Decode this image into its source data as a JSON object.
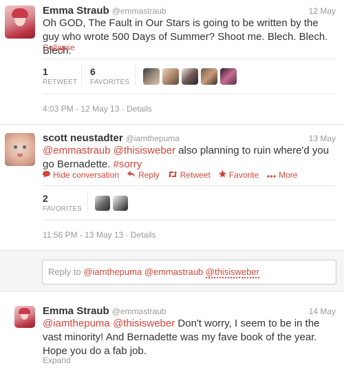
{
  "tweet1": {
    "name": "Emma Straub",
    "handle": "@emmastraub",
    "date": "12 May",
    "text": "Oh GOD, The Fault in Our Stars is going to be written by the guy who wrote 500 Days of Summer? Shoot me. Blech. Blech. Blech.",
    "collapse": "Collapse",
    "retweets_count": "1",
    "retweets_label": "RETWEET",
    "favorites_count": "6",
    "favorites_label": "FAVORITES",
    "timestamp": "4:03 PM - 12 May 13",
    "details": "Details"
  },
  "tweet2": {
    "name": "scott neustadter",
    "handle": "@iamthepuma",
    "date": "13 May",
    "mention1": "@emmastraub",
    "mention2": "@thisisweber",
    "text": "also planning to ruin where'd you go Bernadette.",
    "hashtag": "#sorry",
    "actions": {
      "hide": "Hide conversation",
      "reply": "Reply",
      "retweet": "Retweet",
      "favorite": "Favorite",
      "more": "More"
    },
    "favorites_count": "2",
    "favorites_label": "FAVORITES",
    "timestamp": "11:56 PM - 13 May 13",
    "details": "Details"
  },
  "reply": {
    "prefix": "Reply to",
    "mention1": "@iamthepuma",
    "mention2": "@emmastraub",
    "mention3": "@thisisweber"
  },
  "tweet3": {
    "name": "Emma Straub",
    "handle": "@emmastraub",
    "date": "14 May",
    "mention1": "@iamthepuma",
    "mention2": "@thisisweber",
    "text": "Don't worry, I seem to be in the vast minority! And Bernadette was my fave book of the year. Hope you do a fab job.",
    "expand": "Expand"
  },
  "colors": {
    "accent": "#d2473b",
    "muted": "#999999",
    "text": "#333333"
  }
}
